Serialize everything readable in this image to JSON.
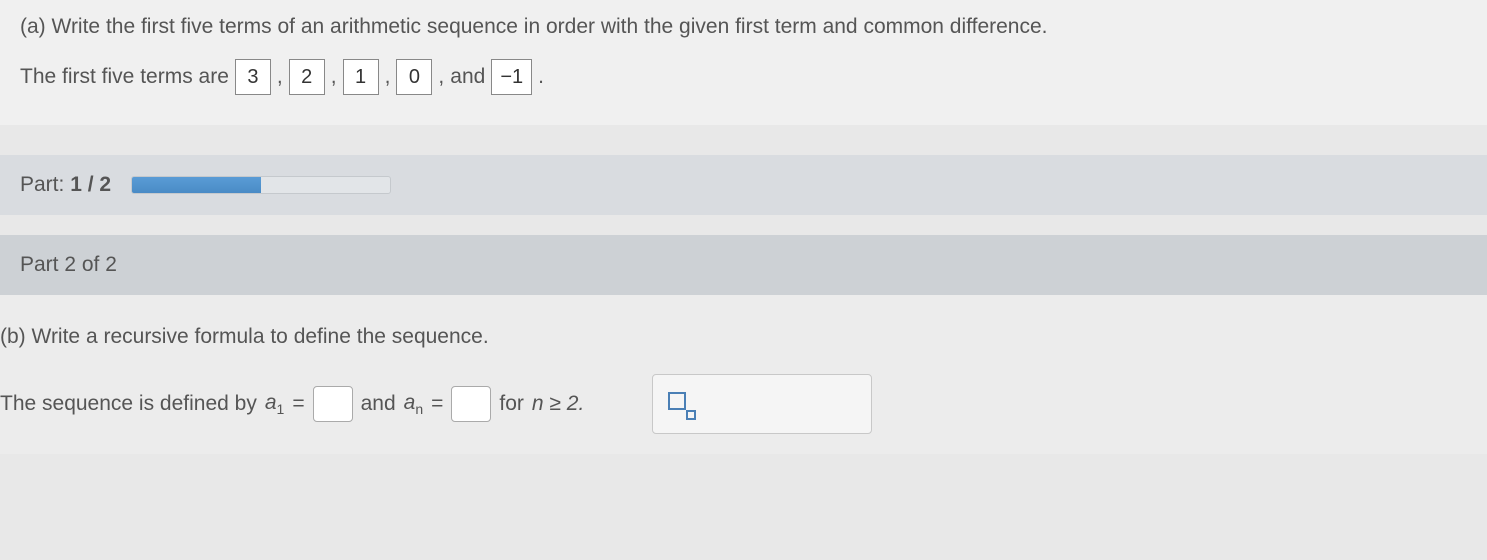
{
  "partA": {
    "question": "(a) Write the first five terms of an arithmetic sequence in order with the given first term and common difference.",
    "leadText": "The first five terms are",
    "terms": [
      "3",
      "2",
      "1",
      "0",
      "−1"
    ],
    "andText": "and",
    "period": "."
  },
  "progress": {
    "label_pre": "Part: ",
    "label_bold": "1 / 2",
    "percent": 50
  },
  "partHeader": "Part 2 of 2",
  "partB": {
    "question": "(b) Write a recursive formula to define the sequence.",
    "leadText": "The sequence is defined by ",
    "a1_html": "a",
    "a1_sub": "1",
    "eq": " = ",
    "andText": " and ",
    "an_html": "a",
    "an_sub": "n",
    "forText": " for ",
    "cond": "n ≥ 2."
  }
}
